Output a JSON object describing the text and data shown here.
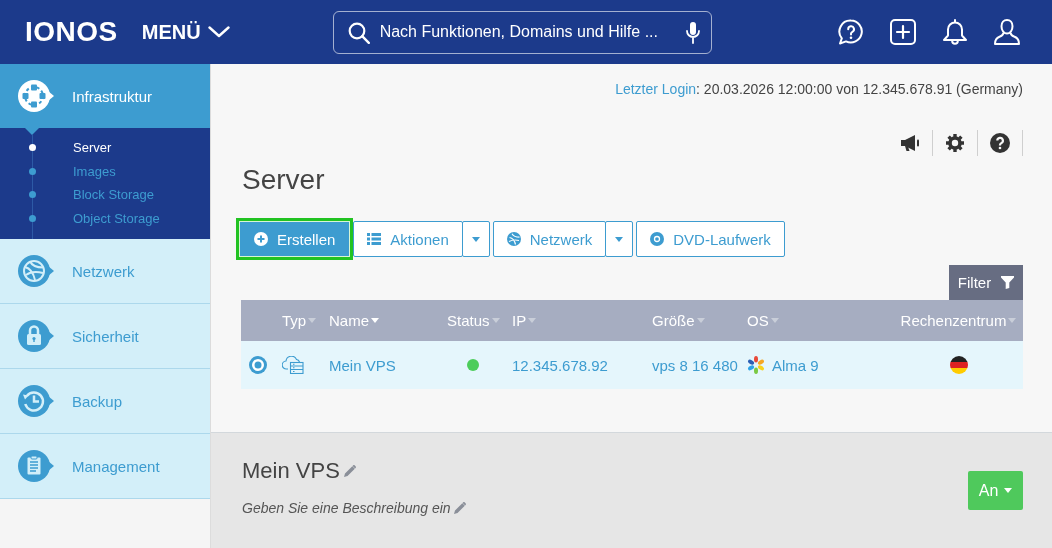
{
  "header": {
    "logo": "IONOS",
    "menu_label": "MENÜ",
    "search": {
      "placeholder": "Nach Funktionen, Domains und Hilfe ..."
    }
  },
  "sidebar": {
    "items": [
      {
        "label": "Infrastruktur",
        "selected": true,
        "children": [
          {
            "label": "Server",
            "selected": true
          },
          {
            "label": "Images",
            "selected": false
          },
          {
            "label": "Block Storage",
            "selected": false
          },
          {
            "label": "Object Storage",
            "selected": false
          }
        ]
      },
      {
        "label": "Netzwerk",
        "selected": false
      },
      {
        "label": "Sicherheit",
        "selected": false
      },
      {
        "label": "Backup",
        "selected": false
      },
      {
        "label": "Management",
        "selected": false
      }
    ]
  },
  "last_login": {
    "link": "Letzter Login",
    "details": ": 20.03.2026 12:00:00 von 12.345.678.91 (Germany)"
  },
  "page_title": "Server",
  "toolbar": [
    {
      "label": "Erstellen",
      "kind": "primary",
      "highlighted": true
    },
    {
      "label": "Aktionen",
      "kind": "split",
      "highlighted": false
    },
    {
      "label": "Netzwerk",
      "kind": "split",
      "highlighted": false
    },
    {
      "label": "DVD-Laufwerk",
      "kind": "plain",
      "highlighted": false
    }
  ],
  "filter_button": {
    "label": "Filter"
  },
  "table": {
    "columns": [
      {
        "label": "Typ",
        "sorted": false
      },
      {
        "label": "Name",
        "sorted": true
      },
      {
        "label": "Status",
        "sorted": false
      },
      {
        "label": "IP",
        "sorted": false
      },
      {
        "label": "Größe",
        "sorted": false
      },
      {
        "label": "OS",
        "sorted": false
      },
      {
        "label": "Rechenzentrum",
        "sorted": false
      }
    ],
    "rows": [
      {
        "selected": true,
        "name": "Mein VPS",
        "status": {
          "color": "#4ccd5b"
        },
        "ip": "12.345.678.92",
        "size": "vps 8 16 480",
        "os": "Alma 9"
      }
    ]
  },
  "detail": {
    "title": "Mein VPS",
    "description": "Geben Sie eine Beschreibung ein",
    "power_button": {
      "label": "An"
    }
  }
}
